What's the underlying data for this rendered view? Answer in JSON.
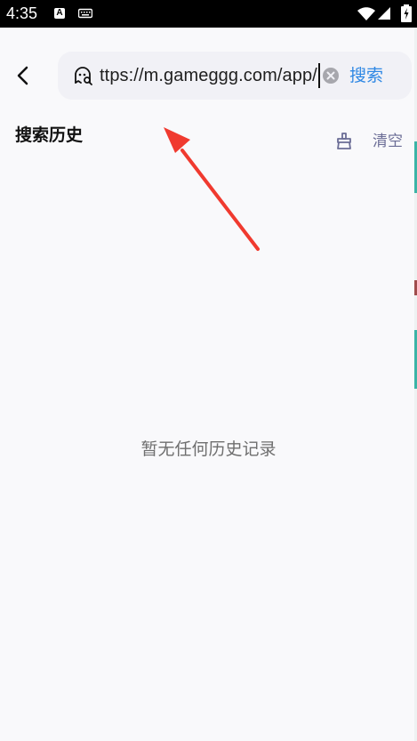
{
  "status_bar": {
    "time": "4:35",
    "input_badge": "A"
  },
  "search": {
    "input_value": "ttps://m.gameggg.com/app/",
    "button_label": "搜索"
  },
  "history": {
    "title": "搜索历史",
    "clear_label": "清空",
    "empty_message": "暂无任何历史记录"
  },
  "colors": {
    "accent_blue": "#2f88e4",
    "annotation_red": "#f03a2f",
    "muted_purple": "#6b6d96"
  },
  "icons": {
    "back": "chevron-left-icon",
    "search_box": "search-ghost-icon",
    "clear_input": "close-circle-icon",
    "clear_history": "broom-icon"
  }
}
